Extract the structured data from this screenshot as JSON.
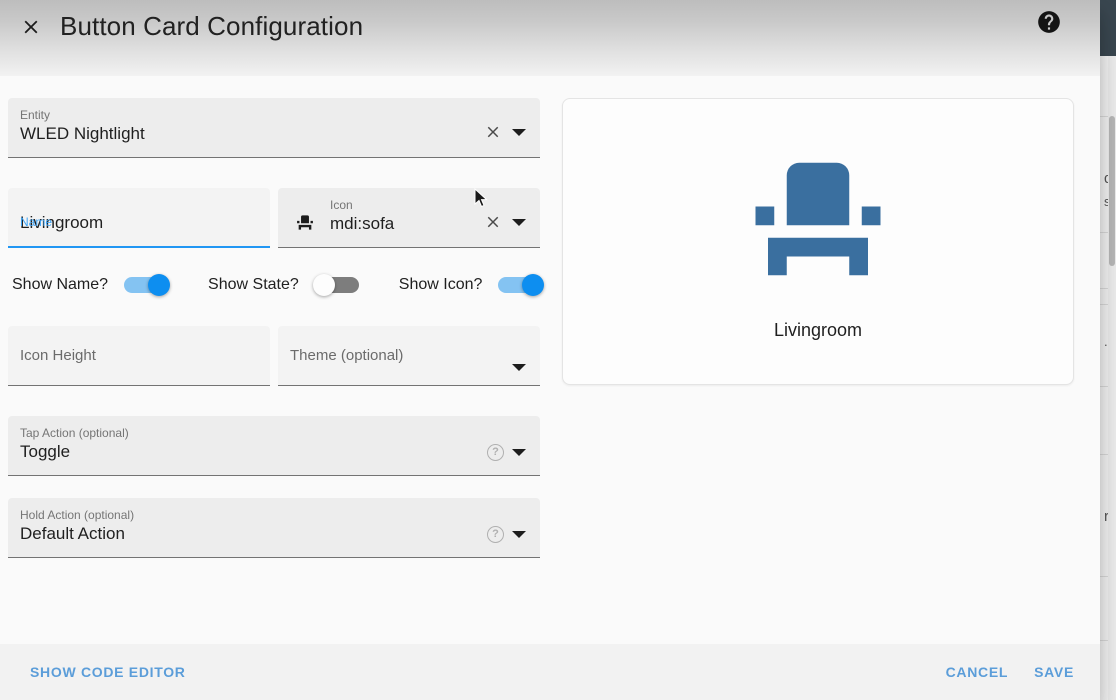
{
  "dialog": {
    "title": "Button Card Configuration",
    "close_icon": "close-icon",
    "help_icon": "help-circle-icon"
  },
  "form": {
    "entity": {
      "label": "Entity",
      "value": "WLED Nightlight",
      "clear_icon": "close-icon",
      "dropdown_icon": "chevron-down-icon"
    },
    "name": {
      "label": "Name",
      "value": "Livingroom",
      "focused": true
    },
    "icon": {
      "label": "Icon",
      "value": "mdi:sofa",
      "leading_icon": "sofa-icon",
      "clear_icon": "close-icon",
      "dropdown_icon": "chevron-down-icon"
    },
    "toggles": [
      {
        "label": "Show Name?",
        "state": "on"
      },
      {
        "label": "Show State?",
        "state": "off"
      },
      {
        "label": "Show Icon?",
        "state": "on"
      }
    ],
    "icon_height": {
      "placeholder": "Icon Height",
      "value": ""
    },
    "theme": {
      "placeholder": "Theme (optional)",
      "value": "",
      "dropdown_icon": "chevron-down-icon"
    },
    "tap_action": {
      "label": "Tap Action (optional)",
      "value": "Toggle",
      "help_icon": "help-circle-icon",
      "dropdown_icon": "chevron-down-icon"
    },
    "hold_action": {
      "label": "Hold Action (optional)",
      "value": "Default Action",
      "help_icon": "help-circle-icon",
      "dropdown_icon": "chevron-down-icon"
    }
  },
  "preview": {
    "icon": "sofa-icon",
    "name": "Livingroom"
  },
  "footer": {
    "show_code_editor": "SHOW CODE EDITOR",
    "cancel": "CANCEL",
    "save": "SAVE"
  },
  "background": {
    "ghost_text_1": "d",
    "ghost_text_2": "s",
    "ghost_text_3": "..",
    "ghost_text_4": "r."
  },
  "colors": {
    "accent_blue": "#2196f3",
    "toggle_on": "#0d8ef0",
    "toggle_on_track": "#84c3f2",
    "toggle_off_track": "#7d7d7d",
    "icon_blue": "#3a6f9f",
    "footer_link": "#5b9dd9",
    "appbar": "#3a4750"
  }
}
